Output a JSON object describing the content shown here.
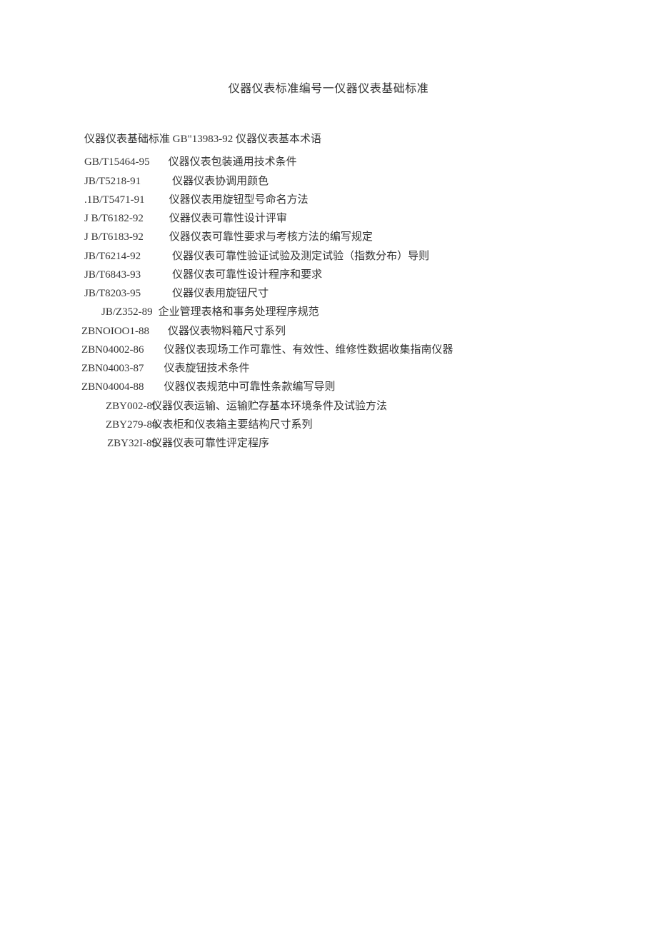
{
  "title": "仪器仪表标准编号一仪器仪表基础标准",
  "intro": "仪器仪表基础标准 GB\"13983-92 仪器仪表基本术语",
  "rows": [
    {
      "code": "GB/T15464-95",
      "off": 0,
      "gap": 26,
      "desc": "仪器仪表包装通用技术条件"
    },
    {
      "code": "JB/T5218-91",
      "off": 0,
      "gap": 44,
      "desc": "仪器仪表协调用颜色"
    },
    {
      "code": ".1B/T5471-91",
      "off": 0,
      "gap": 34,
      "desc": "仪器仪表用旋钮型号命名方法"
    },
    {
      "code": "J B/T6182-92",
      "off": 0,
      "gap": 36,
      "desc": "仪器仪表可靠性设计评审"
    },
    {
      "code": "J B/T6183-92",
      "off": 0,
      "gap": 36,
      "desc": "仪器仪表可靠性要求与考核方法的编写规定"
    },
    {
      "code": "JB/T6214-92",
      "off": 0,
      "gap": 44,
      "desc": "仪器仪表可靠性验证试验及测定试验（指数分布）导则"
    },
    {
      "code": "JB/T6843-93",
      "off": 0,
      "gap": 44,
      "desc": "仪器仪表可靠性设计程序和要求"
    },
    {
      "code": "JB/T8203-95",
      "off": 0,
      "gap": 44,
      "desc": "仪器仪表用旋钮尺寸"
    },
    {
      "code": "JB/Z352-89",
      "off": 24,
      "gap": 32,
      "desc": "企业管理表格和事务处理程序规范"
    },
    {
      "code": "ZBNOIOO1-88",
      "off": -4,
      "gap": 22,
      "desc": "仪器仪表物料箱尺寸系列"
    },
    {
      "code": "ZBN04002-86",
      "off": -4,
      "gap": 24,
      "desc": "仪器仪表现场工作可靠性、有效性、维修性数据收集指南仪器"
    },
    {
      "code": "ZBN04003-87",
      "off": -4,
      "gap": 24,
      "desc": "仪表旋钮技术条件"
    },
    {
      "code": "ZBN04004-88",
      "off": -4,
      "gap": 24,
      "desc": "仪器仪表规范中可靠性条款编写导则"
    },
    {
      "code": "ZBY002-8I",
      "off": 30,
      "gap": 24,
      "desc": "仪器仪表运输、运输贮存基本环境条件及试验方法"
    },
    {
      "code": "ZBY279-84",
      "off": 30,
      "gap": 22,
      "desc": "仪表柜和仪表箱主要结构尺寸系列"
    },
    {
      "code": "ZBY32I-85",
      "off": 32,
      "gap": 24,
      "desc": "仪器仪表可靠性评定程序"
    }
  ]
}
